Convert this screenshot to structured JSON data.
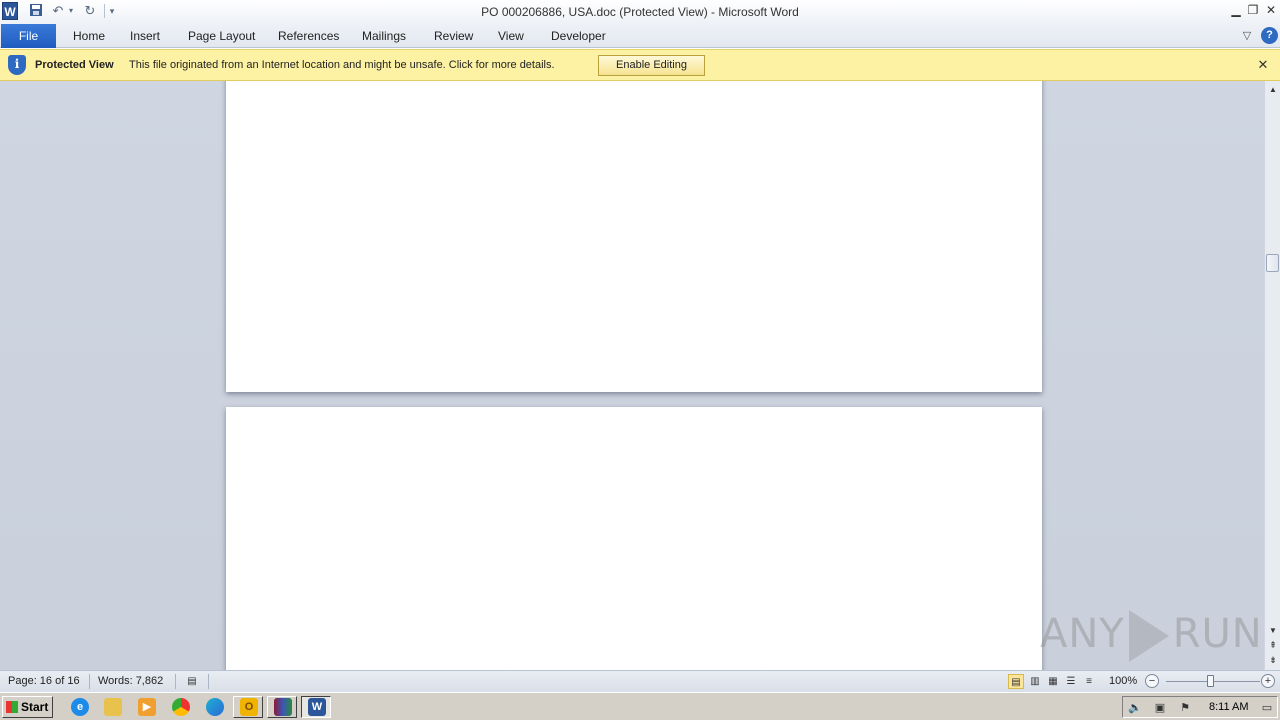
{
  "window": {
    "title": "PO 000206886, USA.doc (Protected View)  -  Microsoft Word",
    "app_icon_letter": "W"
  },
  "quick_access": {
    "save_icon": "save-icon",
    "undo_icon": "undo-icon",
    "redo_icon": "redo-icon",
    "customize_icon": "customize-qat-icon"
  },
  "ribbon": {
    "file_label": "File",
    "tabs": [
      "Home",
      "Insert",
      "Page Layout",
      "References",
      "Mailings",
      "Review",
      "View",
      "Developer"
    ]
  },
  "protected_view": {
    "title": "Protected View",
    "message": "This file originated from an Internet location and might be unsafe. Click for more details.",
    "enable_label": "Enable Editing",
    "info_glyph": "i",
    "close_glyph": "✕"
  },
  "status": {
    "page": "Page: 16 of 16",
    "words": "Words: 7,862",
    "zoom": "100%",
    "zoom_level": 100
  },
  "watermark": {
    "left": "ANY",
    "right": "RUN"
  },
  "taskbar": {
    "start_label": "Start",
    "clock": "8:11 AM",
    "quick_launch": [
      "internet-explorer-icon",
      "file-explorer-icon",
      "media-player-icon",
      "chrome-icon",
      "edge-icon"
    ],
    "tasks": [
      "outlook-icon",
      "winrar-icon",
      "word-icon"
    ]
  },
  "colors": {
    "accent_blue": "#2b579a",
    "protected_bar": "#fdf2a4",
    "document_bg": "#cbd2de"
  }
}
